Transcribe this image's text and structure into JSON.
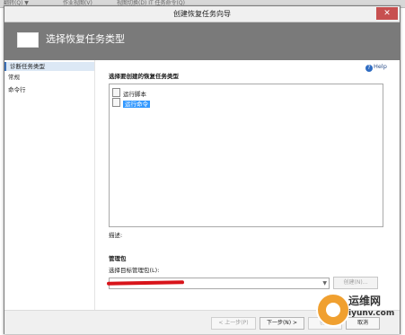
{
  "background": {
    "strip_texts": [
      "翻转(Q) ▼",
      "作业视图(V)",
      "视图切换(D)  IT 任务命令(Q)"
    ]
  },
  "window": {
    "title": "创建恢复任务向导",
    "close_glyph": "✕"
  },
  "header": {
    "title": "选择恢复任务类型"
  },
  "sidebar": {
    "items": [
      {
        "label": "诊断任务类型"
      },
      {
        "label": "常规"
      },
      {
        "label": "命令行"
      }
    ]
  },
  "help": {
    "label": "Help",
    "icon": "help-icon"
  },
  "main": {
    "list_label": "选择要创建的恢复任务类型",
    "list_items": [
      {
        "label": "运行脚本",
        "icon": "document-icon"
      },
      {
        "label": "运行命令",
        "icon": "document-icon",
        "selected": true
      }
    ],
    "description_label": "描述:",
    "mgmt_pack_label": "管理包",
    "target_mp_label": "选择目标管理包(L):",
    "create_button": "创建(N)..."
  },
  "footer": {
    "previous": "< 上一步(P)",
    "next": "下一步(N) >",
    "create": "创建",
    "cancel": "取消"
  },
  "watermark": {
    "line1": "运维网",
    "line2": "iyunv.com"
  },
  "colors": {
    "header_bg": "#7a7a7a",
    "selected_bg": "#3399ff",
    "close_bg": "#c75050",
    "redaction": "#d8141a"
  }
}
